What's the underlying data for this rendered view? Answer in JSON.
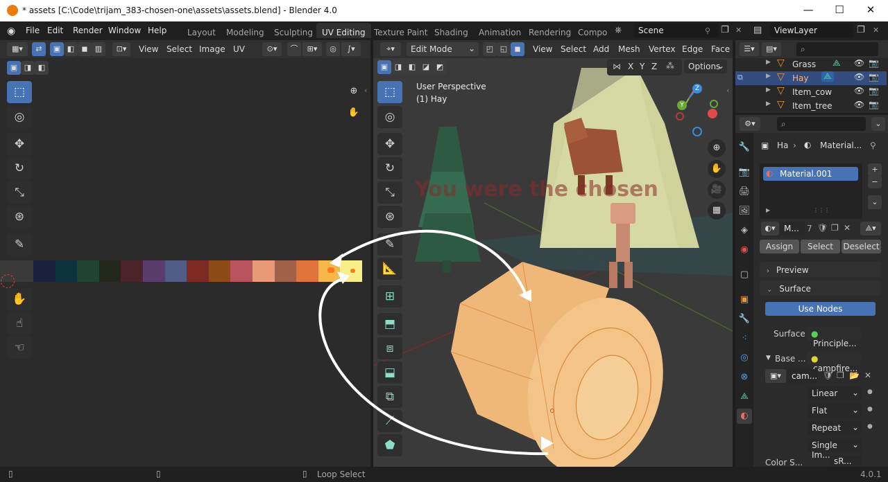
{
  "window": {
    "title": "* assets [C:\\Code\\trijam_383-chosen-one\\assets\\assets.blend] - Blender 4.0",
    "minimize": "—",
    "maximize": "☐",
    "close": "✕"
  },
  "menu": [
    "File",
    "Edit",
    "Render",
    "Window",
    "Help"
  ],
  "workspaces": [
    "Layout",
    "Modeling",
    "Sculpting",
    "UV Editing",
    "Texture Paint",
    "Shading",
    "Animation",
    "Rendering",
    "Compo"
  ],
  "scene": {
    "label": "Scene"
  },
  "view_layer": {
    "label": "ViewLayer"
  },
  "uv_editor": {
    "menus": [
      "View",
      "Select",
      "Image",
      "UV"
    ],
    "palette_colors": [
      "#1a1f3c",
      "#0d3340",
      "#1f4430",
      "#23271c",
      "#4a2428",
      "#5a3d6b",
      "#505c86",
      "#7d2a22",
      "#8c4a14",
      "#b8545e",
      "#e89a78",
      "#a0604a",
      "#e0743a",
      "#f5b64a",
      "#f8ee8a"
    ]
  },
  "viewport": {
    "mode": "Edit Mode",
    "menus": [
      "View",
      "Select",
      "Add",
      "Mesh",
      "Vertex",
      "Edge",
      "Face"
    ],
    "axes": [
      "X",
      "Y",
      "Z"
    ],
    "options": "Options",
    "perspective": "User Perspective",
    "object": "(1) Hay",
    "scene_text": "You were the chosen"
  },
  "outliner": {
    "items": [
      {
        "label": "Grass",
        "selected": false
      },
      {
        "label": "Hay",
        "selected": true
      },
      {
        "label": "Item_cow",
        "selected": false
      },
      {
        "label": "Item_tree",
        "selected": false
      }
    ]
  },
  "properties": {
    "breadcrumb_object": "Ha",
    "breadcrumb_material": "Material...",
    "material_slot": "Material.001",
    "material_name": "M...",
    "user_count": "7",
    "assign": "Assign",
    "select": "Select",
    "deselect": "Deselect",
    "preview_label": "Preview",
    "surface_panel": "Surface",
    "use_nodes": "Use Nodes",
    "surface_label": "Surface",
    "surface_value": "Principle...",
    "base_label": "Base ...",
    "base_value": "campfire...",
    "image_name": "cam...",
    "interpolation": "Linear",
    "projection": "Flat",
    "extension": "Repeat",
    "source": "Single Im...",
    "color_space_label": "Color S...",
    "color_space_value": "sR..."
  },
  "status": {
    "action": "Loop Select",
    "version": "4.0.1"
  }
}
